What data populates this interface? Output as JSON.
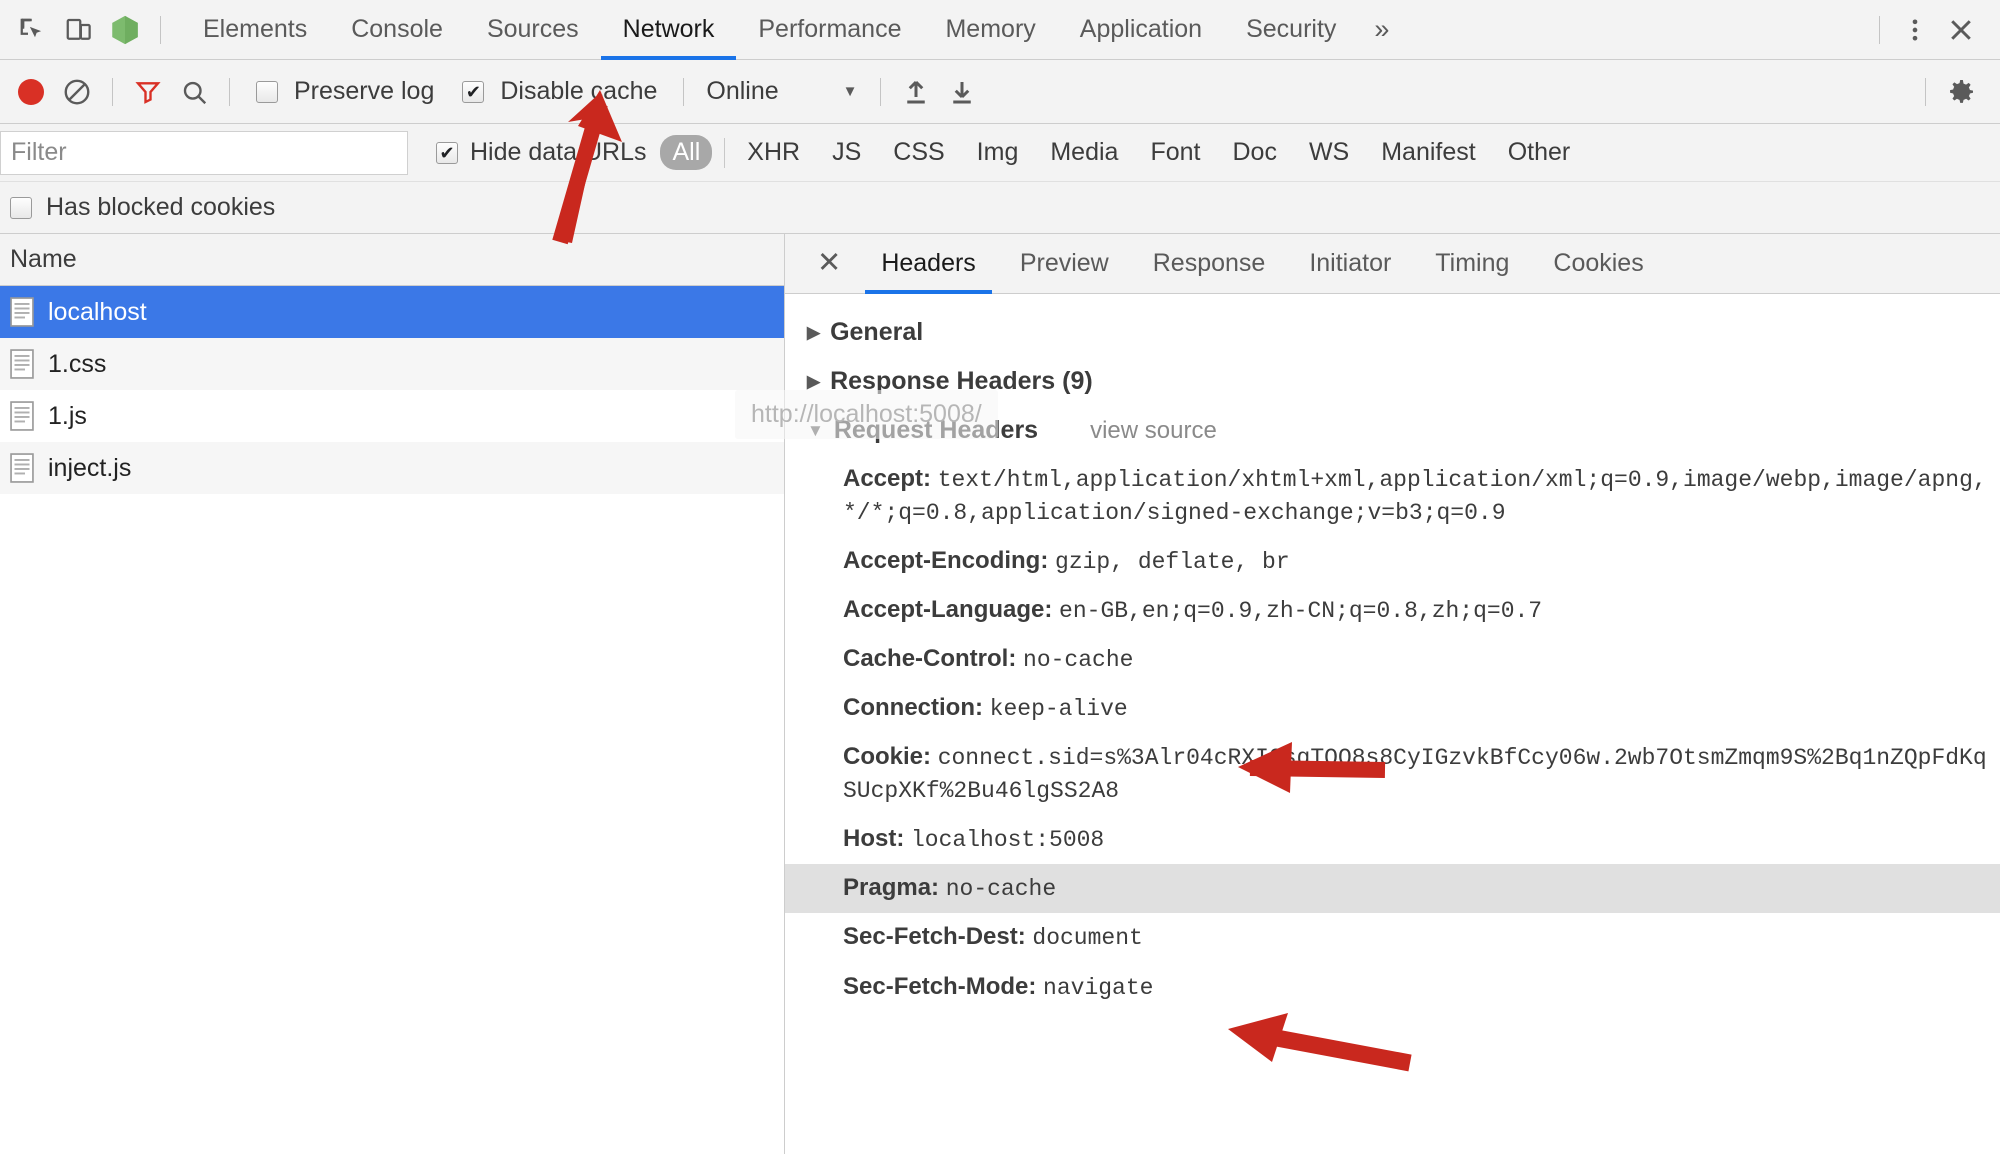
{
  "window": {
    "toolbar_icons": [
      "inspect-element-icon",
      "device-toolbar-icon",
      "node-logo-icon"
    ],
    "more_tabs_label": "»",
    "menu_label": "⋮",
    "close_label": "✕"
  },
  "main_tabs": [
    {
      "label": "Elements",
      "active": false
    },
    {
      "label": "Console",
      "active": false
    },
    {
      "label": "Sources",
      "active": false
    },
    {
      "label": "Network",
      "active": true
    },
    {
      "label": "Performance",
      "active": false
    },
    {
      "label": "Memory",
      "active": false
    },
    {
      "label": "Application",
      "active": false
    },
    {
      "label": "Security",
      "active": false
    }
  ],
  "network_toolbar": {
    "record_tooltip": "record-button",
    "clear_tooltip": "clear-button",
    "filter_tooltip": "filter-button",
    "search_tooltip": "search-button",
    "preserve_log": {
      "label": "Preserve log",
      "checked": false
    },
    "disable_cache": {
      "label": "Disable cache",
      "checked": true
    },
    "throttling": {
      "value": "Online",
      "caret": "▼"
    },
    "import_har": "import-har-icon",
    "export_har": "export-har-icon",
    "settings": "gear-icon"
  },
  "filter_bar": {
    "filter_placeholder": "Filter",
    "filter_value": "",
    "hide_data_urls": {
      "label": "Hide data URLs",
      "checked": true
    },
    "types": [
      {
        "label": "All",
        "active": true
      },
      {
        "label": "XHR",
        "active": false
      },
      {
        "label": "JS",
        "active": false
      },
      {
        "label": "CSS",
        "active": false
      },
      {
        "label": "Img",
        "active": false
      },
      {
        "label": "Media",
        "active": false
      },
      {
        "label": "Font",
        "active": false
      },
      {
        "label": "Doc",
        "active": false
      },
      {
        "label": "WS",
        "active": false
      },
      {
        "label": "Manifest",
        "active": false
      },
      {
        "label": "Other",
        "active": false
      }
    ],
    "has_blocked_cookies": {
      "label": "Has blocked cookies",
      "checked": false
    }
  },
  "request_list": {
    "column_header": "Name",
    "rows": [
      {
        "name": "localhost",
        "selected": true
      },
      {
        "name": "1.css",
        "selected": false
      },
      {
        "name": "1.js",
        "selected": false
      },
      {
        "name": "inject.js",
        "selected": false
      }
    ]
  },
  "detail_tabs": [
    {
      "label": "Headers",
      "active": true
    },
    {
      "label": "Preview",
      "active": false
    },
    {
      "label": "Response",
      "active": false
    },
    {
      "label": "Initiator",
      "active": false
    },
    {
      "label": "Timing",
      "active": false
    },
    {
      "label": "Cookies",
      "active": false
    }
  ],
  "sections": {
    "general": {
      "label": "General",
      "expanded": false,
      "triangle": "▶"
    },
    "response_headers": {
      "label": "Response Headers (9)",
      "expanded": false,
      "triangle": "▶"
    },
    "request_headers": {
      "label": "Request Headers",
      "expanded": true,
      "triangle": "▼",
      "view_source": "view source"
    }
  },
  "request_headers": [
    {
      "name": "Accept:",
      "value": "text/html,application/xhtml+xml,application/xml;q=0.9,image/webp,image/apng,*/*;q=0.8,application/signed-exchange;v=b3;q=0.9",
      "highlight": false
    },
    {
      "name": "Accept-Encoding:",
      "value": "gzip, deflate, br",
      "highlight": false
    },
    {
      "name": "Accept-Language:",
      "value": "en-GB,en;q=0.9,zh-CN;q=0.8,zh;q=0.7",
      "highlight": false
    },
    {
      "name": "Cache-Control:",
      "value": "no-cache",
      "highlight": false
    },
    {
      "name": "Connection:",
      "value": "keep-alive",
      "highlight": false
    },
    {
      "name": "Cookie:",
      "value": "connect.sid=s%3Alr04cRXIOsgTQQ8s8CyIGzvkBfCcy06w.2wb7OtsmZmqm9S%2Bq1nZQpFdKqSUcpXKf%2Bu46lgSS2A8",
      "highlight": false
    },
    {
      "name": "Host:",
      "value": "localhost:5008",
      "highlight": false
    },
    {
      "name": "Pragma:",
      "value": "no-cache",
      "highlight": true
    },
    {
      "name": "Sec-Fetch-Dest:",
      "value": "document",
      "highlight": false
    },
    {
      "name": "Sec-Fetch-Mode:",
      "value": "navigate",
      "highlight": false
    }
  ],
  "tooltip": {
    "text": "http://localhost:5008/"
  },
  "annotations": {
    "arrow_color": "#c9281e",
    "arrows": [
      {
        "name": "arrow-to-disable-cache",
        "points_at": "Disable cache checkbox"
      },
      {
        "name": "arrow-to-cache-control",
        "points_at": "Cache-Control: no-cache"
      },
      {
        "name": "arrow-to-pragma",
        "points_at": "Pragma: no-cache"
      }
    ]
  },
  "colors": {
    "accent": "#1a73e8",
    "selection": "#3b78e7",
    "record": "#d93025",
    "annotation": "#c9281e",
    "chrome_bg": "#f3f3f3"
  }
}
